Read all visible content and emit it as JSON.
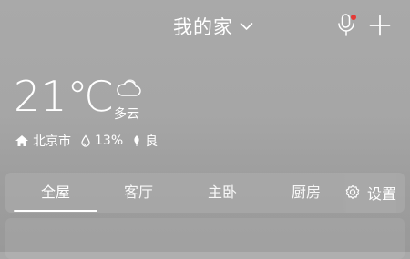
{
  "header": {
    "home_title": "我的家",
    "icons": [
      "chevron-down-icon",
      "microphone-icon",
      "plus-icon"
    ],
    "mic_badge_color": "#e53935"
  },
  "weather": {
    "temperature": "21℃",
    "condition": "多云",
    "condition_icon": "cloud-icon",
    "location": "北京市",
    "humidity": "13%",
    "air_quality": "良"
  },
  "tabs": {
    "items": [
      {
        "label": "全屋",
        "active": true
      },
      {
        "label": "客厅",
        "active": false
      },
      {
        "label": "主卧",
        "active": false
      },
      {
        "label": "厨房",
        "active": false
      }
    ],
    "settings_label": "设置"
  },
  "colors": {
    "background": "#a6a6a6",
    "text": "#ffffff",
    "badge": "#e53935"
  }
}
